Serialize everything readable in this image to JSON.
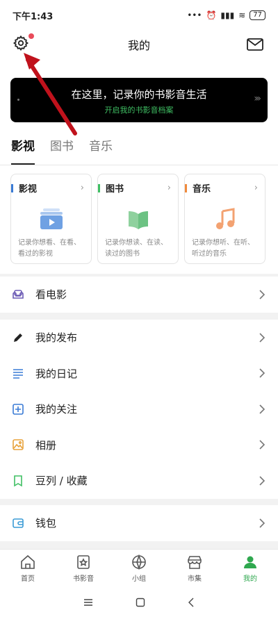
{
  "status": {
    "time": "下午1:43",
    "battery": "77"
  },
  "header": {
    "title": "我的"
  },
  "banner": {
    "title": "在这里，记录你的书影音生活",
    "subtitle": "开启我的书影音档案"
  },
  "tabs": [
    {
      "label": "影视"
    },
    {
      "label": "图书"
    },
    {
      "label": "音乐"
    }
  ],
  "cards": [
    {
      "title": "影视",
      "desc": "记录你想看、在看、看过的影视",
      "accent": "#3a7bd5"
    },
    {
      "title": "图书",
      "desc": "记录你想读、在读、读过的图书",
      "accent": "#3fbf63"
    },
    {
      "title": "音乐",
      "desc": "记录你想听、在听、听过的音乐",
      "accent": "#f08a3c"
    }
  ],
  "menu": {
    "movie": "看电影",
    "posts": "我的发布",
    "diary": "我的日记",
    "follow": "我的关注",
    "album": "相册",
    "doulist": "豆列 / 收藏",
    "wallet": "钱包"
  },
  "tabbar": [
    {
      "label": "首页"
    },
    {
      "label": "书影音"
    },
    {
      "label": "小组"
    },
    {
      "label": "市集"
    },
    {
      "label": "我的"
    }
  ]
}
